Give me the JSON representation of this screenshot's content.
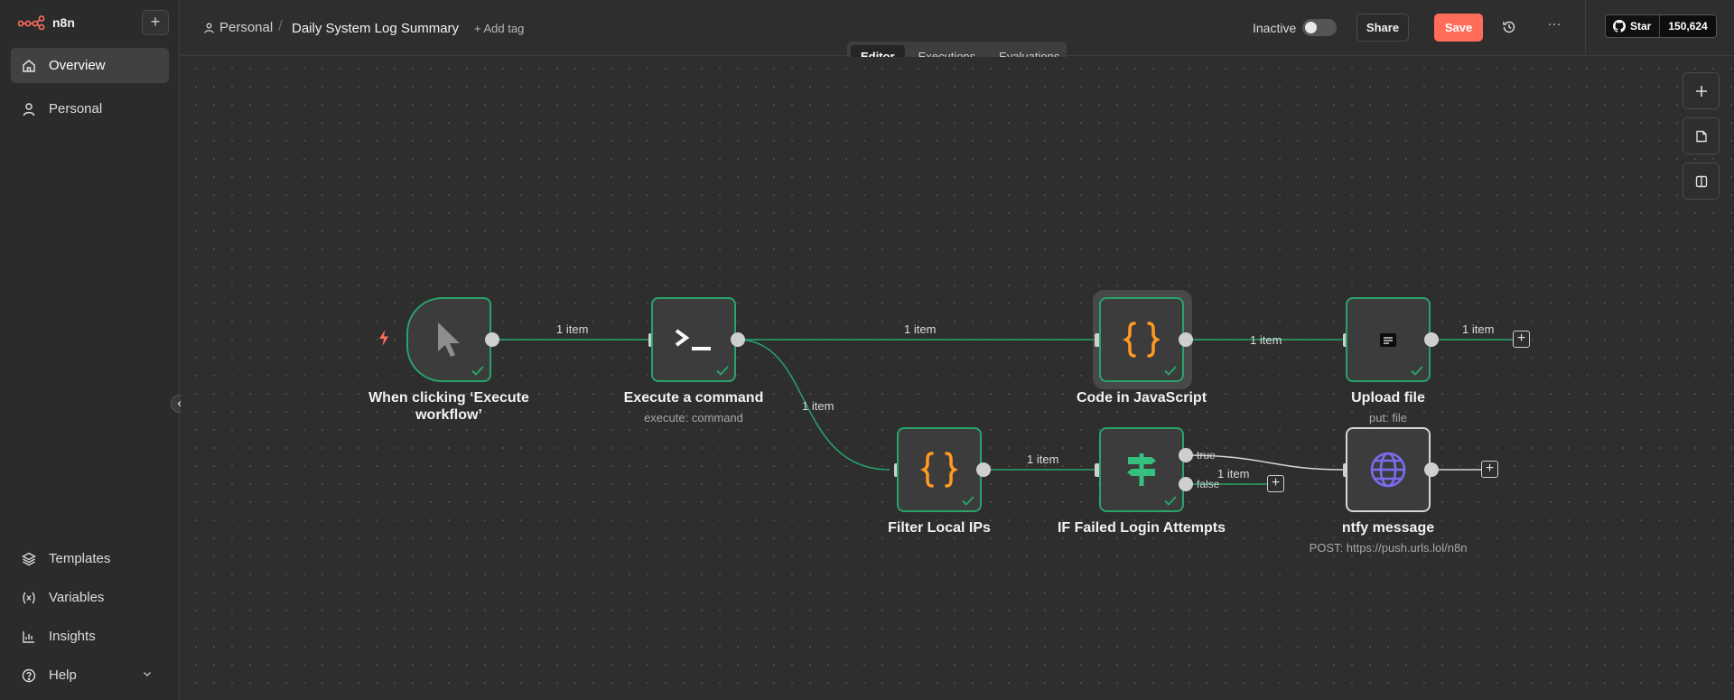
{
  "app": {
    "logo_text": "n8n",
    "brand_color": "#ff6d5a",
    "success_color": "#29a36a"
  },
  "sidebar": {
    "add_label": "+",
    "items": [
      {
        "label": "Overview",
        "icon": "home-icon",
        "active": true
      },
      {
        "label": "Personal",
        "icon": "user-icon",
        "active": false
      }
    ],
    "bottom_items": [
      {
        "label": "Templates",
        "icon": "templates-icon"
      },
      {
        "label": "Variables",
        "icon": "variables-icon"
      },
      {
        "label": "Insights",
        "icon": "insights-icon"
      },
      {
        "label": "Help",
        "icon": "help-icon"
      }
    ]
  },
  "header": {
    "project": "Personal",
    "workflow_name": "Daily System Log Summary",
    "add_tag": "+ Add tag",
    "status_label": "Inactive",
    "share_label": "Share",
    "save_label": "Save",
    "more_label": "···",
    "github": {
      "star_label": "Star",
      "star_count": "150,624"
    }
  },
  "tabs": [
    {
      "label": "Editor",
      "active": true
    },
    {
      "label": "Executions",
      "active": false
    },
    {
      "label": "Evaluations",
      "active": false
    }
  ],
  "nodes": [
    {
      "id": "trigger",
      "title": "When clicking ‘Execute workflow’",
      "subtitle": "",
      "icon": "cursor-icon"
    },
    {
      "id": "execute",
      "title": "Execute a command",
      "subtitle": "execute: command",
      "icon": "terminal-icon"
    },
    {
      "id": "code",
      "title": "Code in JavaScript",
      "subtitle": "",
      "icon": "code-braces-icon"
    },
    {
      "id": "upload",
      "title": "Upload file",
      "subtitle": "put: file",
      "icon": "file-icon"
    },
    {
      "id": "filter",
      "title": "Filter Local IPs",
      "subtitle": "",
      "icon": "code-braces-icon"
    },
    {
      "id": "if",
      "title": "IF Failed Login Attempts",
      "subtitle": "",
      "icon": "signpost-icon"
    },
    {
      "id": "ntfy",
      "title": "ntfy message",
      "subtitle": "POST: https://push.urls.lol/n8n",
      "icon": "globe-icon"
    }
  ],
  "edges": {
    "trigger_execute": "1 item",
    "execute_code": "1 item",
    "code_upload": "1 item",
    "upload_out": "1 item",
    "execute_filter": "1 item",
    "filter_if": "1 item",
    "if_false": "1 item"
  },
  "branches": {
    "true_label": "true",
    "false_label": "false"
  }
}
